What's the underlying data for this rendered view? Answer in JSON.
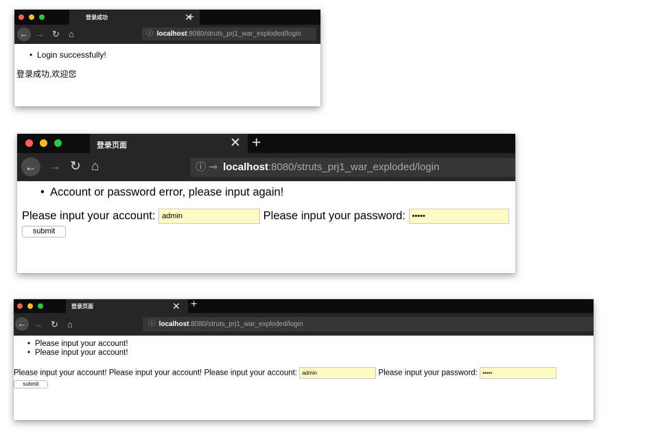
{
  "colors": {
    "close": "#ff5f57",
    "minimize": "#febc2e",
    "zoom": "#28c840",
    "field_bg": "#fff9c4",
    "tabbar_bg": "#0c0c0c",
    "toolbar_bg": "#262626"
  },
  "icons": [
    "close-icon",
    "plus-icon",
    "back-arrow-icon",
    "forward-arrow-icon",
    "reload-icon",
    "home-icon",
    "info-icon",
    "key-icon"
  ],
  "windows": [
    {
      "tab_title": "登录成功",
      "url_host": "localhost",
      "url_rest": ":8080/struts_prj1_war_exploded/login",
      "messages": [
        "Login successfully!"
      ],
      "welcome": "登录成功,欢迎您"
    },
    {
      "tab_title": "登录页面",
      "url_host": "localhost",
      "url_rest": ":8080/struts_prj1_war_exploded/login",
      "messages": [
        "Account or password error, please input again!"
      ],
      "form": {
        "account_label": "Please input your account:",
        "account_value": "admin",
        "password_label": "Please input your password:",
        "password_value": "•••••",
        "submit_label": "submit"
      }
    },
    {
      "tab_title": "登录页面",
      "url_host": "localhost",
      "url_rest": ":8080/struts_prj1_war_exploded/login",
      "messages": [
        "Please input your account!",
        "Please input your account!"
      ],
      "form": {
        "prefix_text": "Please input your account! Please input your account!",
        "account_label": "Please input your account:",
        "account_value": "admin",
        "password_label": "Please input your password:",
        "password_value": "•••••",
        "submit_label": "submit"
      }
    }
  ]
}
